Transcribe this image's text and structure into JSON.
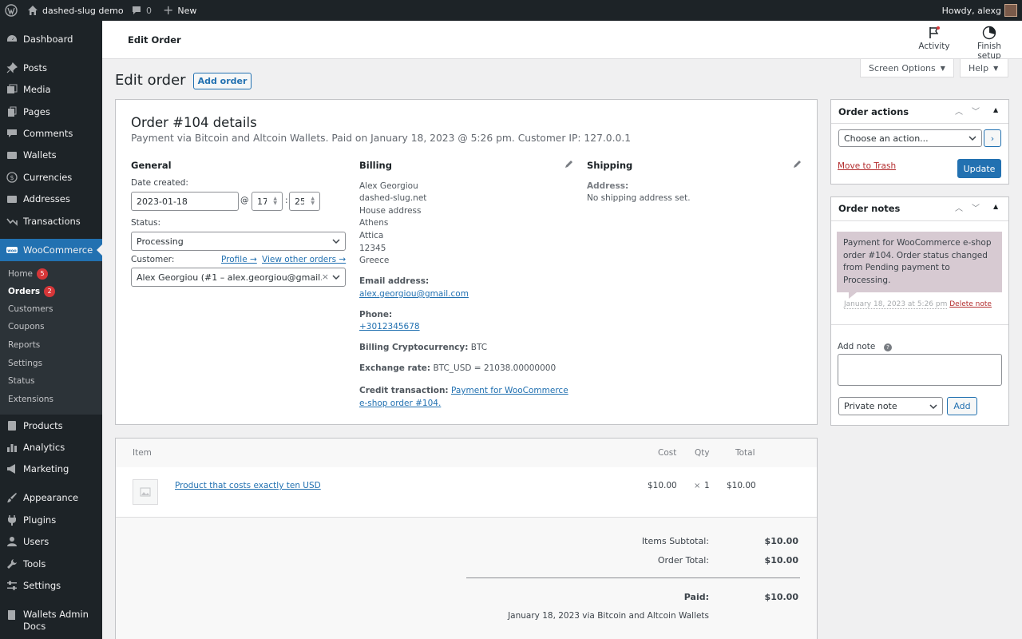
{
  "adminbar": {
    "site_name": "dashed-slug demo",
    "comments_count": "0",
    "new_label": "New",
    "howdy": "Howdy, alexg"
  },
  "sidebar": {
    "dashboard": "Dashboard",
    "posts": "Posts",
    "media": "Media",
    "pages": "Pages",
    "comments": "Comments",
    "wallets": "Wallets",
    "currencies": "Currencies",
    "addresses": "Addresses",
    "transactions": "Transactions",
    "woocommerce": "WooCommerce",
    "sub": {
      "home": "Home",
      "home_count": "5",
      "orders": "Orders",
      "orders_count": "2",
      "customers": "Customers",
      "coupons": "Coupons",
      "reports": "Reports",
      "settings": "Settings",
      "status": "Status",
      "extensions": "Extensions"
    },
    "products": "Products",
    "analytics": "Analytics",
    "marketing": "Marketing",
    "appearance": "Appearance",
    "plugins": "Plugins",
    "users": "Users",
    "tools": "Tools",
    "settings": "Settings",
    "wallets_docs_1": "Wallets Admin",
    "wallets_docs_2": "Docs"
  },
  "wc_header": {
    "title": "Edit Order",
    "activity": "Activity",
    "finish_setup": "Finish setup"
  },
  "screen_options": "Screen Options",
  "help": "Help",
  "page": {
    "title": "Edit order",
    "add_order": "Add order"
  },
  "order": {
    "heading": "Order #104 details",
    "subheading": "Payment via Bitcoin and Altcoin Wallets. Paid on January 18, 2023 @ 5:26 pm. Customer IP: 127.0.0.1",
    "general": {
      "title": "General",
      "date_label": "Date created:",
      "date": "2023-01-18",
      "at": "@",
      "hour": "17",
      "colon": ":",
      "minute": "25",
      "status_label": "Status:",
      "status": "Processing",
      "customer_label": "Customer:",
      "profile_link": "Profile →",
      "other_orders_link": "View other orders →",
      "customer": "Alex Georgiou (#1 – alex.georgiou@gmail...."
    },
    "billing": {
      "title": "Billing",
      "lines": [
        "Alex Georgiou",
        "dashed-slug.net",
        "House address",
        "Athens",
        "Attica",
        "12345",
        "Greece"
      ],
      "email_label": "Email address:",
      "email": "alex.georgiou@gmail.com",
      "phone_label": "Phone:",
      "phone": "+3012345678",
      "crypto_label": "Billing Cryptocurrency:",
      "crypto": "BTC",
      "rate_label": "Exchange rate:",
      "rate": "BTC_USD = 21038.00000000",
      "credit_label": "Credit transaction:",
      "credit_link_1": "Payment for WooCommerce",
      "credit_link_2": "e-shop order #104."
    },
    "shipping": {
      "title": "Shipping",
      "address_label": "Address:",
      "address": "No shipping address set."
    }
  },
  "items": {
    "headers": {
      "item": "Item",
      "cost": "Cost",
      "qty": "Qty",
      "total": "Total"
    },
    "rows": [
      {
        "name": "Product that costs exactly ten USD",
        "cost": "$10.00",
        "qty_x": "×",
        "qty": "1",
        "total": "$10.00"
      }
    ],
    "totals": {
      "subtotal_label": "Items Subtotal:",
      "subtotal": "$10.00",
      "order_total_label": "Order Total:",
      "order_total": "$10.00",
      "paid_label": "Paid:",
      "paid": "$10.00",
      "paid_note": "January 18, 2023 via Bitcoin and Altcoin Wallets"
    }
  },
  "order_actions": {
    "title": "Order actions",
    "select": "Choose an action...",
    "trash": "Move to Trash",
    "update": "Update"
  },
  "order_notes": {
    "title": "Order notes",
    "note_text": "Payment for WooCommerce e-shop order #104. Order status changed from Pending payment to Processing.",
    "note_meta": "January 18, 2023 at 5:26 pm",
    "delete": "Delete note",
    "add_note_label": "Add note",
    "note_type": "Private note",
    "add": "Add"
  }
}
